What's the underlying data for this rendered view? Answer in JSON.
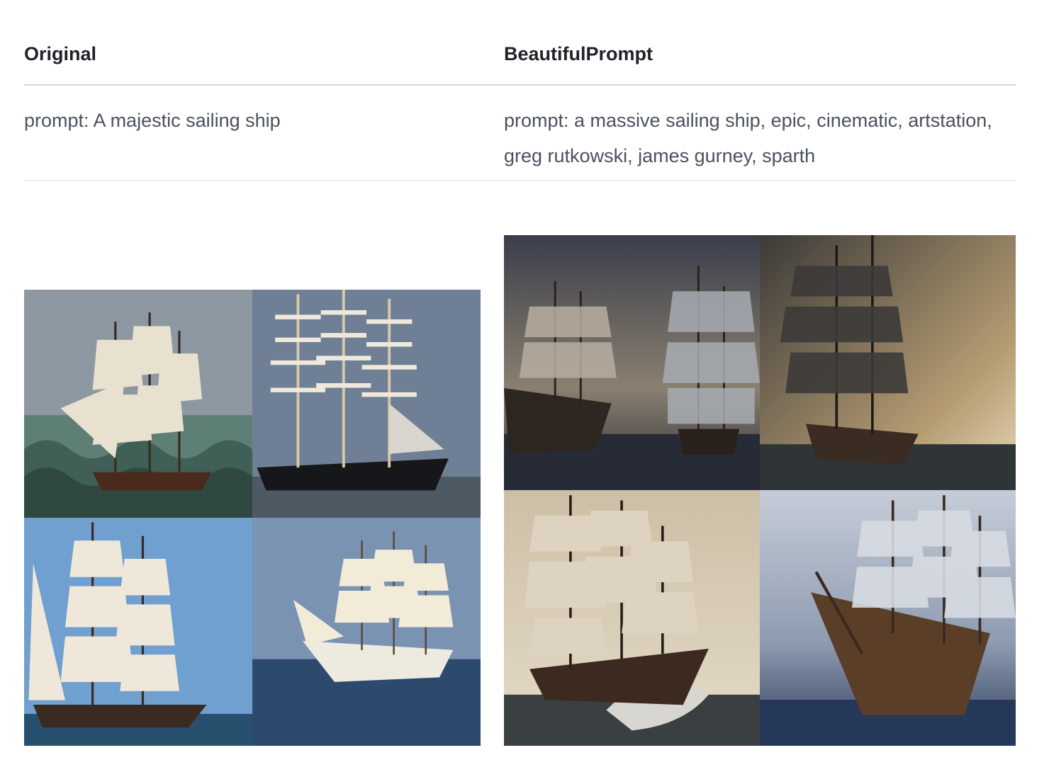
{
  "table": {
    "headers": [
      "Original",
      "BeautifulPrompt"
    ],
    "prompts": [
      "prompt: A majestic sailing ship",
      "prompt: a massive sailing ship, epic, cinematic, artstation, greg rutkowski, james gurney, sparth"
    ]
  },
  "images": {
    "original": [
      {
        "description": "painted tall ship on choppy green waves, grey sky"
      },
      {
        "description": "photo of a three-masted tall ship with furled sails, black hull"
      },
      {
        "description": "tall ship with white sails under blue sky"
      },
      {
        "description": "white-hulled tall ship sailing on deep blue sea"
      }
    ],
    "beautifulprompt": [
      {
        "description": "two galleons in stormy sea, dark clouds"
      },
      {
        "description": "dark galleon with ragged sails in golden mist"
      },
      {
        "description": "galleon with tan sails crashing through waves, sepia sky"
      },
      {
        "description": "wooden warship in blue-grey storm"
      }
    ]
  },
  "colors": {
    "header_text": "#1f2328",
    "prompt_text": "#4a5160",
    "divider": "#d4d6da"
  }
}
